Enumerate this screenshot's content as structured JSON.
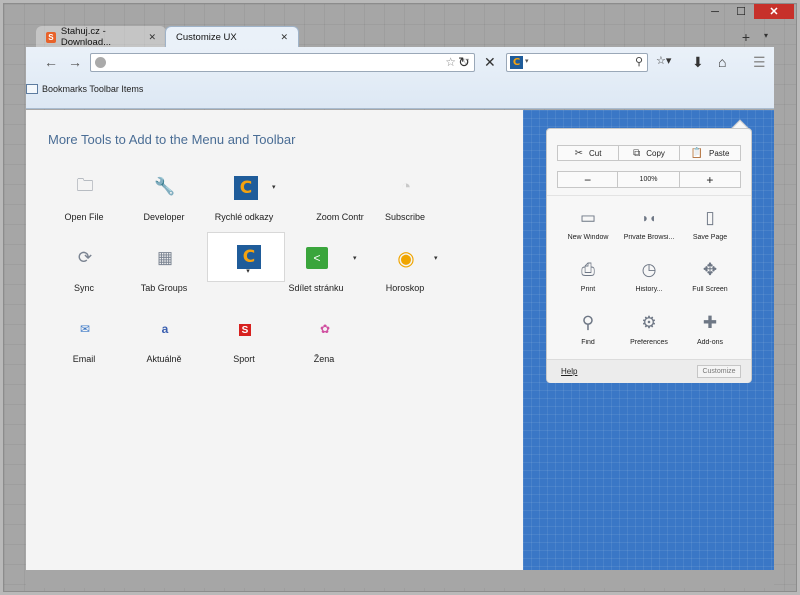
{
  "window": {
    "controls": {
      "minimize": "─",
      "maximize": "☐",
      "close": "✕"
    }
  },
  "tabs": [
    {
      "label": "Stahuj.cz - Download...",
      "close": "✕"
    },
    {
      "label": "Customize UX",
      "close": "✕"
    }
  ],
  "toolbar": {
    "new_tab": "+",
    "tab_list": "▾",
    "back": "←",
    "forward": "→",
    "url_value": "",
    "star": "☆",
    "url_dropdown": "▽",
    "reload": "↻",
    "stop": "✕",
    "search_value": "",
    "search_engine_logo": "C",
    "search_dd": "▾",
    "search_icon": "⚲",
    "bookmarks_menu": "☆▾",
    "downloads": "⬇",
    "home": "⌂",
    "menu": "☰"
  },
  "bookmarks_bar": {
    "label": "Bookmarks Toolbar Items"
  },
  "palette": {
    "title": "More Tools to Add to the Menu and Toolbar",
    "items": [
      {
        "label": "Open File",
        "icon": "folder-icon",
        "glyph": "🗀"
      },
      {
        "label": "Developer",
        "icon": "wrench-icon",
        "glyph": "🔧"
      },
      {
        "label": "Rychlé odkazy",
        "icon": "c-logo-icon",
        "glyph": "C",
        "arrow": "▾"
      },
      {
        "label": "Zoom Contr",
        "icon": "zoom-icon",
        "glyph": ""
      },
      {
        "label": "Subscribe",
        "icon": "rss-icon",
        "glyph": "◔"
      },
      {
        "label": "Sync",
        "icon": "sync-icon",
        "glyph": "⟳"
      },
      {
        "label": "Tab Groups",
        "icon": "tab-groups-icon",
        "glyph": "▦"
      },
      {
        "label": "",
        "icon": "c-logo-icon",
        "glyph": "C",
        "arrow": "▾"
      },
      {
        "label": "Sdílet stránku",
        "icon": "share-icon",
        "glyph": "<",
        "arrow": "▾"
      },
      {
        "label": "Horoskop",
        "icon": "horoscope-icon",
        "glyph": "◉",
        "arrow": "▾"
      },
      {
        "label": "Email",
        "icon": "email-icon",
        "glyph": "✉"
      },
      {
        "label": "Aktuálně",
        "icon": "aktualne-icon",
        "glyph": "a"
      },
      {
        "label": "Sport",
        "icon": "sport-icon",
        "glyph": "S"
      },
      {
        "label": "Žena",
        "icon": "zena-icon",
        "glyph": "✿"
      }
    ]
  },
  "menu_panel": {
    "edit": {
      "cut": "Cut",
      "copy": "Copy",
      "paste": "Paste"
    },
    "zoom": {
      "minus": "−",
      "value": "100%",
      "plus": "+"
    },
    "items": [
      {
        "label": "New Window",
        "icon": "new-window-icon",
        "glyph": "▭"
      },
      {
        "label": "Private Browsi...",
        "icon": "private-browsing-icon",
        "glyph": "◗◖"
      },
      {
        "label": "Save Page",
        "icon": "save-page-icon",
        "glyph": "▯"
      },
      {
        "label": "Print",
        "icon": "print-icon",
        "glyph": "⎙"
      },
      {
        "label": "History...",
        "icon": "history-icon",
        "glyph": "◷"
      },
      {
        "label": "Full Screen",
        "icon": "fullscreen-icon",
        "glyph": "✥"
      },
      {
        "label": "Find",
        "icon": "find-icon",
        "glyph": "⚲"
      },
      {
        "label": "Preferences",
        "icon": "preferences-icon",
        "glyph": "⚙"
      },
      {
        "label": "Add-ons",
        "icon": "addons-icon",
        "glyph": "✚"
      }
    ],
    "help": "Help",
    "customize": "Customize"
  }
}
